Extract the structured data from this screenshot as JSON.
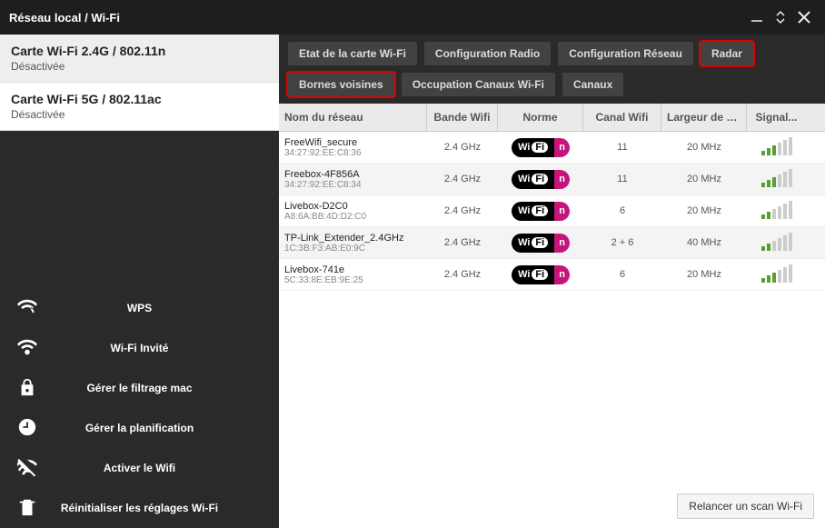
{
  "window": {
    "title": "Réseau local / Wi-Fi"
  },
  "cards": [
    {
      "title": "Carte Wi-Fi 2.4G / 802.11n",
      "status": "Désactivée"
    },
    {
      "title": "Carte Wi-Fi 5G / 802.11ac",
      "status": "Désactivée"
    }
  ],
  "menu": {
    "wps": "WPS",
    "guest": "Wi-Fi Invité",
    "mac": "Gérer le filtrage mac",
    "sched": "Gérer la planification",
    "enable": "Activer le Wifi",
    "reset": "Réinitialiser les réglages Wi-Fi"
  },
  "tabs_top": {
    "state": "Etat de la carte Wi-Fi",
    "radio": "Configuration Radio",
    "network": "Configuration Réseau",
    "radar": "Radar"
  },
  "tabs_sub": {
    "neighbors": "Bornes voisines",
    "occupation": "Occupation Canaux Wi-Fi",
    "channels": "Canaux"
  },
  "columns": {
    "name": "Nom du réseau",
    "band": "Bande Wifi",
    "norm": "Norme",
    "channel": "Canal Wifi",
    "width": "Largeur de b...",
    "signal": "Signal..."
  },
  "rows": [
    {
      "name": "FreeWifi_secure",
      "mac": "34:27:92:EE:C8:36",
      "band": "2.4 GHz",
      "norm": "n",
      "channel": "11",
      "width": "20 MHz",
      "signal": 3
    },
    {
      "name": "Freebox-4F856A",
      "mac": "34:27:92:EE:C8:34",
      "band": "2.4 GHz",
      "norm": "n",
      "channel": "11",
      "width": "20 MHz",
      "signal": 3
    },
    {
      "name": "Livebox-D2C0",
      "mac": "A8:6A:BB:4D:D2:C0",
      "band": "2.4 GHz",
      "norm": "n",
      "channel": "6",
      "width": "20 MHz",
      "signal": 2
    },
    {
      "name": "TP-Link_Extender_2.4GHz",
      "mac": "1C:3B:F3:AB:E0:9C",
      "band": "2.4 GHz",
      "norm": "n",
      "channel": "2 + 6",
      "width": "40 MHz",
      "signal": 2
    },
    {
      "name": "Livebox-741e",
      "mac": "5C:33:8E:EB:9E:25",
      "band": "2.4 GHz",
      "norm": "n",
      "channel": "6",
      "width": "20 MHz",
      "signal": 3
    }
  ],
  "footer": {
    "rescan": "Relancer un scan Wi-Fi"
  }
}
